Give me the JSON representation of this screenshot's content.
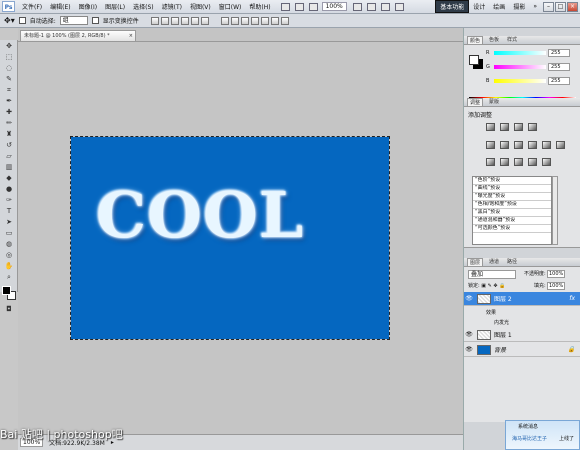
{
  "menubar": {
    "app_logo": "Ps",
    "items": [
      "文件(F)",
      "编辑(E)",
      "图像(I)",
      "图层(L)",
      "选择(S)",
      "滤镜(T)",
      "视图(V)",
      "窗口(W)",
      "帮助(H)"
    ],
    "zoom": "100%",
    "workspace_active": "基本功能",
    "workspace_links": [
      "设计",
      "绘画",
      "摄影"
    ],
    "more": "»"
  },
  "options": {
    "auto_select_label": "自动选择:",
    "auto_select_value": "组",
    "show_transform_label": "显示变换控件"
  },
  "document": {
    "tab_title": "未标题-1 @ 100% (图层 2, RGB/8) *",
    "tab_close": "×",
    "canvas_color": "#0567c0",
    "text": "COOL"
  },
  "status": {
    "zoom": "100%",
    "doc_info": "文档:922.9K/2.38M"
  },
  "watermark": {
    "text": "Bai 贴吧 | photoshop吧"
  },
  "color_panel": {
    "tabs": [
      "颜色",
      "色板",
      "样式"
    ],
    "sliders": [
      {
        "label": "R",
        "value": "255",
        "color": "#ff4040"
      },
      {
        "label": "G",
        "value": "255",
        "color": "#40d040"
      },
      {
        "label": "B",
        "value": "255",
        "color": "#4080ff"
      }
    ]
  },
  "adjust_panel": {
    "tabs": [
      "调整",
      "蒙版"
    ],
    "title": "添加调整",
    "presets": [
      "“色阶”预设",
      "“曲线”预设",
      "“曝光度”预设",
      "“色相/饱和度”预设",
      "“黑白”预设",
      "“通道混和器”预设",
      "“可选颜色”预设"
    ]
  },
  "layers_panel": {
    "tabs": [
      "图层",
      "通道",
      "路径"
    ],
    "blend_mode": "叠加",
    "opacity_label": "不透明度:",
    "opacity": "100%",
    "lock_label": "锁定:",
    "fill_label": "填充:",
    "fill": "100%",
    "layers": [
      {
        "name": "图层 2",
        "selected": true,
        "fx": "fx"
      },
      {
        "name": "图层 1",
        "selected": false,
        "fx": ""
      },
      {
        "name": "背景",
        "selected": false,
        "fx": ""
      }
    ],
    "effects_label": "效果",
    "effect_name": "内发光"
  },
  "notification": {
    "title": "系统消息",
    "user": "海马哥比达王子",
    "action": "上线了"
  }
}
